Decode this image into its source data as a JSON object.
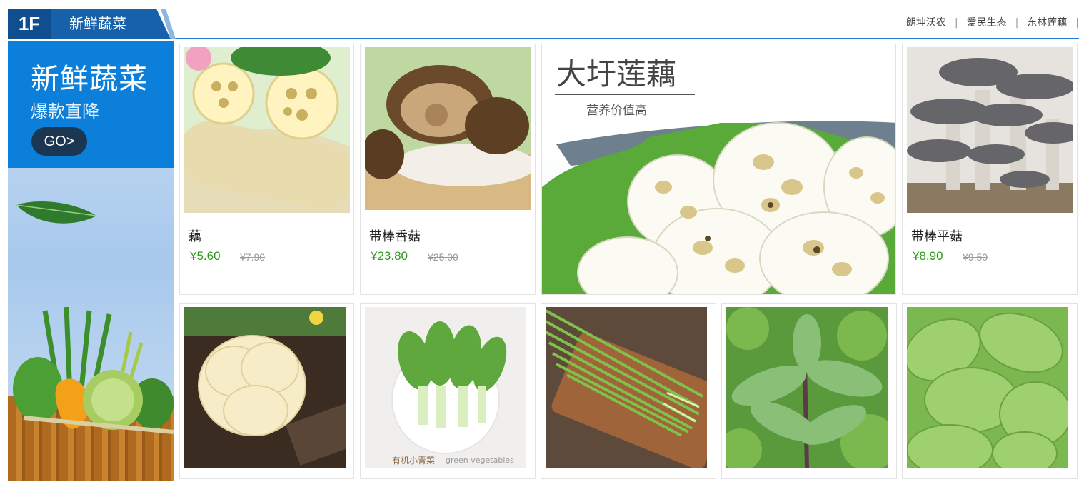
{
  "floor": {
    "number": "1F",
    "title": "新鲜蔬菜"
  },
  "brands": [
    "朗坤沃农",
    "爱民生态",
    "东林莲藕"
  ],
  "banner": {
    "headline": "新鲜蔬菜",
    "subline": "爆款直降",
    "go_label": "GO>"
  },
  "featured": {
    "title": "大圩莲藕",
    "subtitle": "营养价值高"
  },
  "products": [
    {
      "name": "藕",
      "price": "¥5.60",
      "old_price": "¥7.90"
    },
    {
      "name": "带棒香菇",
      "price": "¥23.80",
      "old_price": "¥25.00"
    },
    {
      "name": "带棒平菇",
      "price": "¥8.90",
      "old_price": "¥9.50"
    }
  ],
  "bottom_caption": {
    "cn": "有机小青菜",
    "en": "green vegetables"
  },
  "colors": {
    "accent": "#1e7bd8",
    "banner_blue": "#0b7fd9",
    "price_green": "#2e9a1c"
  }
}
